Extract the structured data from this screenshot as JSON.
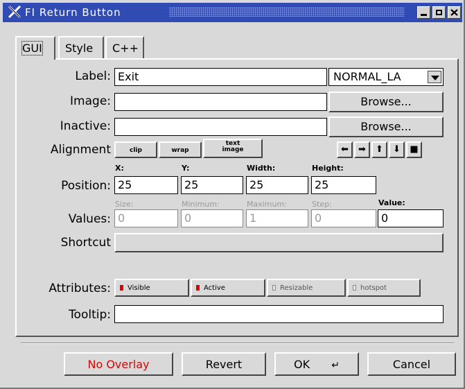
{
  "window": {
    "title": "FI Return Button",
    "controls": [
      "minimize-icon",
      "maximize-icon",
      "close-icon"
    ]
  },
  "tabs": [
    {
      "label": "GUI",
      "active": true
    },
    {
      "label": "Style",
      "active": false
    },
    {
      "label": "C++",
      "active": false
    }
  ],
  "form": {
    "label": {
      "label": "Label:",
      "value": "Exit",
      "type_value": "NORMAL_LA"
    },
    "image": {
      "label": "Image:",
      "value": "",
      "browse": "Browse..."
    },
    "inactive": {
      "label": "Inactive:",
      "value": "",
      "browse": "Browse..."
    },
    "alignment": {
      "label": "Alignment",
      "buttons": [
        "clip",
        "wrap",
        "text\nimage"
      ],
      "arrows": [
        "left-arrow-icon",
        "right-arrow-icon",
        "up-arrow-icon",
        "down-arrow-icon",
        "center-square-icon"
      ]
    },
    "position": {
      "label": "Position:",
      "x_label": "X:",
      "x": "25",
      "y_label": "Y:",
      "y": "25",
      "w_label": "Width:",
      "w": "25",
      "h_label": "Height:",
      "h": "25"
    },
    "values": {
      "label": "Values:",
      "size_label": "Size:",
      "size": "0",
      "min_label": "Minimum:",
      "min": "0",
      "max_label": "Maximum:",
      "max": "1",
      "step_label": "Step:",
      "step": "0",
      "value_label": "Value:",
      "value": "0"
    },
    "shortcut": {
      "label": "Shortcut",
      "value": ""
    },
    "attributes": {
      "label": "Attributes:",
      "items": [
        {
          "label": "Visible",
          "checked": true
        },
        {
          "label": "Active",
          "checked": true
        },
        {
          "label": "Resizable",
          "checked": false
        },
        {
          "label": "hotspot",
          "checked": false
        }
      ]
    },
    "tooltip": {
      "label": "Tooltip:",
      "value": ""
    }
  },
  "footer": {
    "no_overlay": "No Overlay",
    "revert": "Revert",
    "ok": "OK",
    "ok_shortcut": "↵",
    "cancel": "Cancel"
  },
  "colors": {
    "title_bar": "#2d46a8",
    "no_overlay_text": "#e00000",
    "checked": "#e00000"
  }
}
